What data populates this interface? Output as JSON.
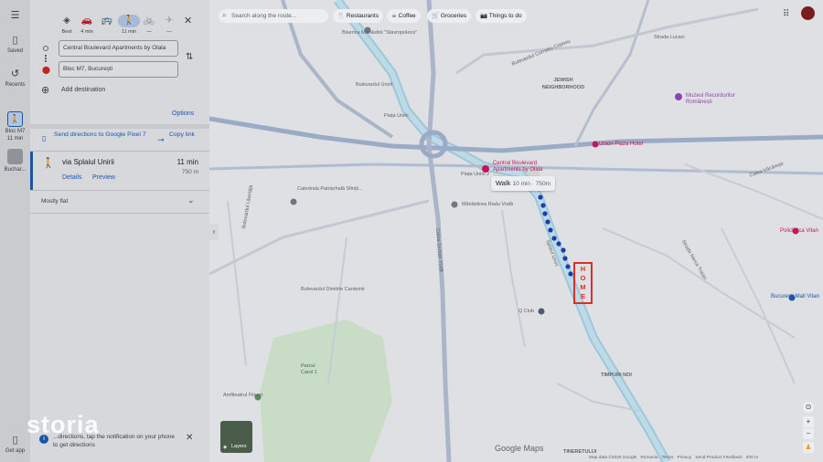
{
  "rail": {
    "menu_icon": "menu-icon",
    "saved_label": "Saved",
    "recents_label": "Recents",
    "recent1_title": "Bloc M7",
    "recent1_sub": "11 min",
    "recent2_title": "Buchar...",
    "getapp_label": "Get app"
  },
  "modes": [
    {
      "name": "best",
      "label": "Best"
    },
    {
      "name": "drive",
      "label": "4 min"
    },
    {
      "name": "transit",
      "label": ""
    },
    {
      "name": "walk",
      "label": "11 min"
    },
    {
      "name": "bike",
      "label": "—"
    },
    {
      "name": "flight",
      "label": "—"
    }
  ],
  "directions": {
    "origin": "Central Boulevard Apartments by Olala",
    "destination": "Bloc M7, București",
    "add_destination": "Add destination",
    "options": "Options",
    "send_to_device": "Send directions to Google Pixel 7",
    "copy_link": "Copy link"
  },
  "route": {
    "via": "via Splaiul Unirii",
    "time": "11 min",
    "distance": "750 m",
    "details": "Details",
    "preview": "Preview",
    "terrain": "Mostly flat"
  },
  "notice": {
    "text": "...directions, tap the notification on your phone to get directions",
    "brand_watermark": "storia"
  },
  "map": {
    "search_placeholder": "Search along the route...",
    "chips": [
      "Restaurants",
      "Coffee",
      "Groceries",
      "Things to do"
    ],
    "walk_callout_main": "Walk",
    "walk_callout_detail": "10 min · 750m",
    "home_marker": "HOME",
    "layers_label": "Layers",
    "google_maps_logo": "Google Maps",
    "footer": [
      "Map data ©2026 Google",
      "Romania",
      "Terms",
      "Privacy",
      "Send Product Feedback",
      "200 m"
    ],
    "labels": {
      "biserica": "Biserica Mănăstirii \"Stavropoleos\"",
      "jewish": "JEWISH NEIGHBORHOOD",
      "muzeu": "Muzeul Recordurilor Românești",
      "union_plaza": "Union Plaza Hotel",
      "central_blvd": "Central Boulevard Apartments by Olala",
      "catedrala": "Catedrala Patriarhală Sfinții...",
      "manastirea": "Mănăstirea Radu Vodă",
      "qclub": "Q Club",
      "parcul": "Parcul Carol 1",
      "timpuri": "TIMPURI NOI",
      "tineretului": "TINERETULUI",
      "policlinica": "Policlinica Vitan",
      "bucuresti_mall": "București Mall Vitan",
      "piata_unirii": "Piața Unirii",
      "piata_unirii_2": "Piața Unirii 2",
      "amfiteatrul": "Amfiteatrul Filaret",
      "blvd_libertatii": "Bulevardul Libertății",
      "splaiul": "Splaiul Unirii",
      "calea_serban": "Calea Șerban Vodă",
      "blvd_corneliu": "Bulevardul Corneliu Coposu",
      "blvd_unirii": "Bulevardul Unirii",
      "strada_nerva": "Strada Nerva Traian",
      "blvd_dimitrie": "Bulevardul Dimitrie Cantemir",
      "strada_lucaci": "Strada Lucaci",
      "calea_vacaresti": "Calea Văcărești"
    }
  }
}
